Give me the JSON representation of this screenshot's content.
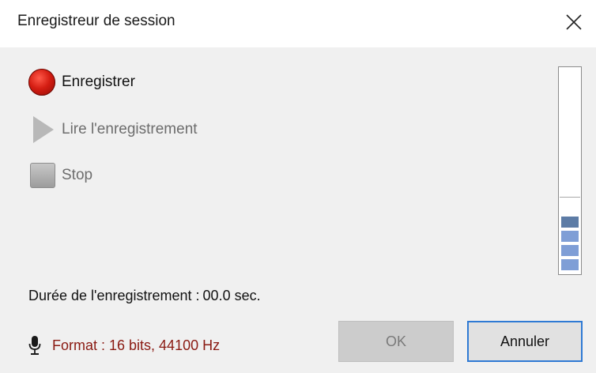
{
  "window": {
    "title": "Enregistreur de session"
  },
  "actions": {
    "record": {
      "label": "Enregistrer",
      "enabled": true
    },
    "play": {
      "label": "Lire l'enregistrement",
      "enabled": false
    },
    "stop": {
      "label": "Stop",
      "enabled": false
    }
  },
  "level_meter": {
    "active_segments": 4,
    "segment_colors": [
      "#5d7ca6",
      "#7f9ed6",
      "#7f9ed6",
      "#7f9ed6"
    ]
  },
  "duration": {
    "label": "Durée de l'enregistrement :",
    "value": "00.0 sec."
  },
  "format": {
    "label": "Format : 16 bits, 44100 Hz",
    "icon": "microphone-icon"
  },
  "buttons": {
    "ok": {
      "label": "OK",
      "enabled": false
    },
    "cancel": {
      "label": "Annuler",
      "enabled": true
    }
  },
  "colors": {
    "record": "#d41d12",
    "format_text": "#8a1a12",
    "focus_border": "#2f7ad4"
  }
}
